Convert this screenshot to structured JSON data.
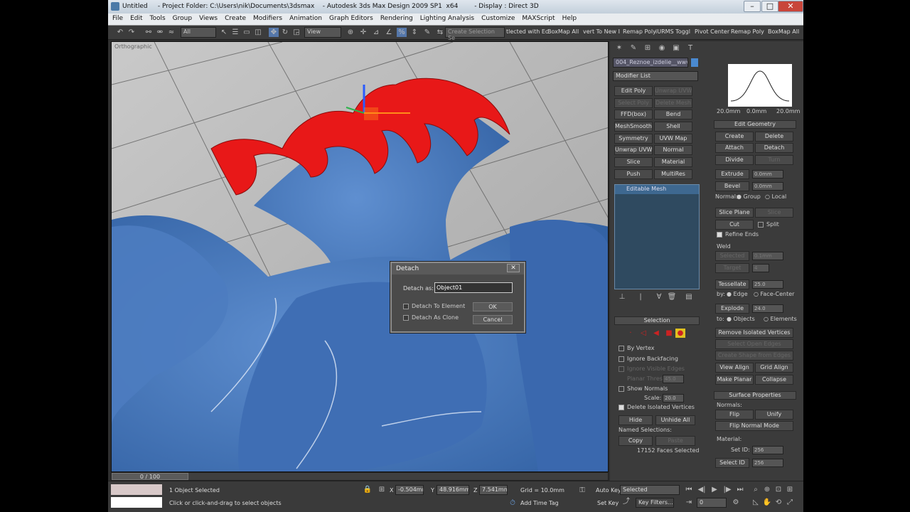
{
  "titlebar": {
    "title": "Untitled     - Project Folder: C:\\Users\\nik\\Documents\\3dsmax    - Autodesk 3ds Max Design 2009 SP1  x64        - Display : Direct 3D",
    "min": "–",
    "max": "□",
    "close": "✕"
  },
  "menu": [
    "File",
    "Edit",
    "Tools",
    "Group",
    "Views",
    "Create",
    "Modifiers",
    "Animation",
    "Graph Editors",
    "Rendering",
    "Lighting Analysis",
    "Customize",
    "MAXScript",
    "Help"
  ],
  "toolbar": {
    "filter": "All",
    "refcoord": "View",
    "named_sel": "Create Selection Se",
    "quick": [
      "tlected with Ec",
      "BoxMap All",
      "vert To New I",
      "Remap Poly",
      "iURMS Toggl",
      "Pivot Center",
      "Remap Poly",
      "BoxMap All"
    ]
  },
  "viewport": {
    "label": "Orthographic"
  },
  "detach": {
    "title": "Detach",
    "close": "✕",
    "as_label": "Detach as:",
    "name": "Object01",
    "to_element": "Detach To Element",
    "as_clone": "Detach As Clone",
    "ok": "OK",
    "cancel": "Cancel"
  },
  "panel": {
    "object_name": "004_Reznoe_izdelie__www.fc",
    "modifier_list": "Modifier List",
    "modifiers": [
      "Edit Poly",
      "Unwrap UVW",
      "Select Poly",
      "Delete Mesh",
      "FFD(box)",
      "Bend",
      "MeshSmooth",
      "Shell",
      "Symmetry",
      "UVW Map",
      "Unwrap UVW",
      "Normal",
      "Slice",
      "Material",
      "Push",
      "MultiRes"
    ],
    "stack_item": "Editable Mesh",
    "selection_title": "Selection",
    "by_vertex": "By Vertex",
    "ignore_backfacing": "Ignore Backfacing",
    "by_angle": "Ignore Visible Edges",
    "planar_thresh": "Planar Thresh:",
    "planar_val": "45.0",
    "show_normals": "Show Normals",
    "scale_label": "Scale:",
    "scale_val": "20.0",
    "delete_isolated": "Delete Isolated Vertices",
    "hide": "Hide",
    "unhide_all": "Unhide All",
    "named_selections": "Named Selections:",
    "copy": "Copy",
    "paste": "Paste",
    "faces_selected": "17152 Faces Selected",
    "curve_left": "20.0mm",
    "curve_mid": "0.0mm",
    "curve_right": "20.0mm",
    "edit_geometry": "Edit Geometry",
    "create": "Create",
    "delete": "Delete",
    "attach": "Attach",
    "detach": "Detach",
    "divide": "Divide",
    "turn": "Turn",
    "extrude": "Extrude",
    "extrude_val": "0.0mm",
    "bevel": "Bevel",
    "bevel_val": "0.0mm",
    "normal": "Normal:",
    "group": "Group",
    "local": "Local",
    "slice_plane": "Slice Plane",
    "slice": "Slice",
    "cut": "Cut",
    "split": "Split",
    "refine_ends": "Refine Ends",
    "weld": "Weld",
    "selected": "Selected",
    "selected_val": "0.1mm",
    "target": "Target",
    "target_val": "4",
    "tessellate": "Tessellate",
    "tess_val": "25.0",
    "by": "by:",
    "edge": "Edge",
    "face_center": "Face-Center",
    "explode": "Explode",
    "explode_val": "24.0",
    "to": "to:",
    "objects": "Objects",
    "elements": "Elements",
    "remove_isolated": "Remove Isolated Vertices",
    "select_open": "Select Open Edges",
    "create_shape": "Create Shape from Edges",
    "view_align": "View Align",
    "grid_align": "Grid Align",
    "make_planar": "Make Planar",
    "collapse": "Collapse",
    "surface_props": "Surface Properties",
    "normals": "Normals:",
    "flip": "Flip",
    "unify": "Unify",
    "flip_normal_mode": "Flip Normal Mode",
    "material": "Material:",
    "set_id": "Set ID:",
    "set_id_val": "256",
    "select_id": "Select ID",
    "select_id_val": "256"
  },
  "status": {
    "timeslider": "0 / 100",
    "objects_selected": "1 Object Selected",
    "prompt": "Click or click-and-drag to select objects",
    "x": "-0.504mm",
    "y": "48.916mm",
    "z": "7.541mm",
    "grid": "Grid = 10.0mm",
    "auto_key": "Auto Key",
    "selected": "Selected",
    "set_key": "Set Key",
    "key_filters": "Key Filters...",
    "add_time_tag": "Add Time Tag",
    "frame": "0"
  }
}
